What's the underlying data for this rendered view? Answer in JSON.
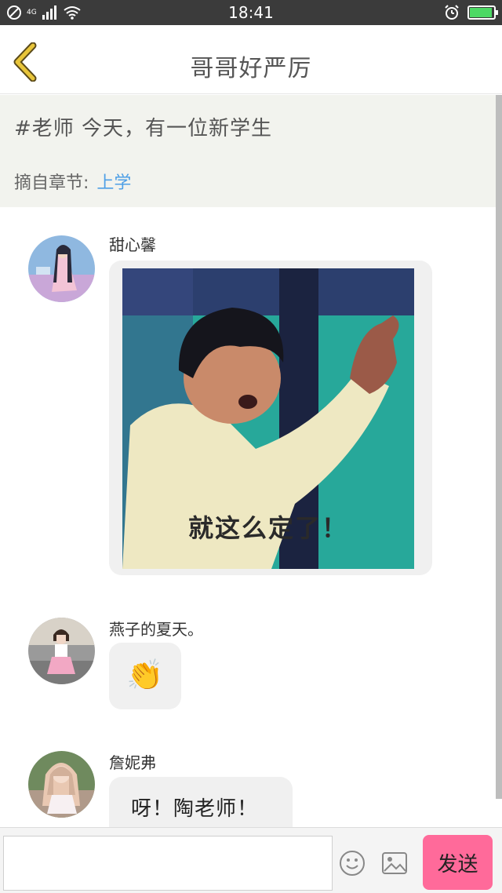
{
  "status_bar": {
    "time": "18:41",
    "network": "4G"
  },
  "header": {
    "title": "哥哥好严厉"
  },
  "quote": {
    "text": "#老师 今天，有一位新学生",
    "source_label": "摘自章节:",
    "chapter": "上学"
  },
  "messages": [
    {
      "user": "甜心馨",
      "type": "image",
      "image_caption": "就这么定了！"
    },
    {
      "user": "燕子的夏天。",
      "type": "emoji",
      "emoji": "👏"
    },
    {
      "user": "詹妮弗",
      "type": "text",
      "text": "呀！陶老师！"
    }
  ],
  "composer": {
    "placeholder": "",
    "send_label": "发送"
  },
  "colors": {
    "accent_send": "#ff6a9a",
    "chapter_link": "#4e9fe6",
    "quote_bg": "#f2f3ee",
    "back_icon": "#e8c53a"
  }
}
